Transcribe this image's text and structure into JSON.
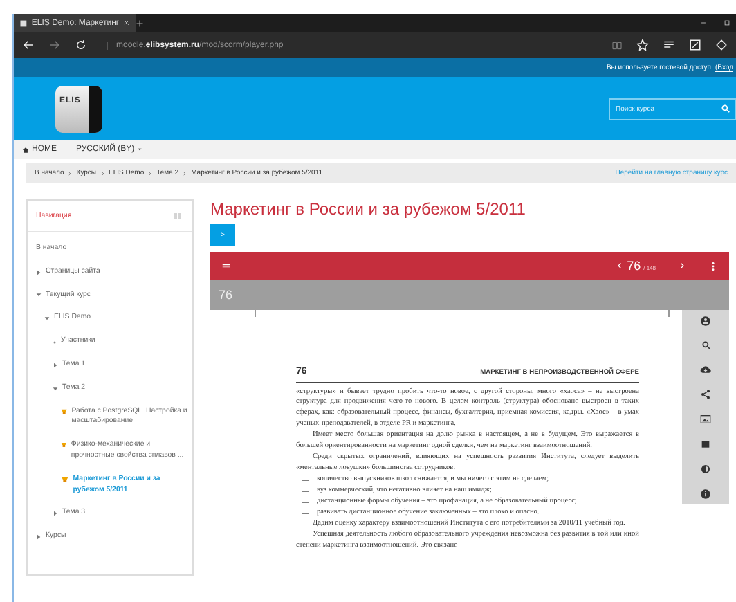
{
  "browser": {
    "tab_title": "ELIS Demo: Маркетинг",
    "url_host": "moodle.",
    "url_domain": "elibsystem.ru",
    "url_path": "/mod/scorm/player.php"
  },
  "guest_bar": {
    "text": "Вы используете гостевой доступ",
    "login": "(Вход"
  },
  "header": {
    "logo": "ELIS",
    "search": {
      "placeholder": "Поиск курса"
    }
  },
  "nav": {
    "home": "HOME",
    "language": "РУССКИЙ (BY)"
  },
  "breadcrumb": {
    "items": [
      "В начало",
      "Курсы",
      "ELIS Demo",
      "Тема 2",
      "Маркетинг в России и за рубежом 5/2011"
    ],
    "course_link": "Перейти на главную страницу курс"
  },
  "navigation": {
    "title": "Навигация",
    "items": [
      {
        "label": "В начало",
        "kind": "plain"
      },
      {
        "label": "Страницы сайта",
        "kind": "node",
        "expanded": false
      },
      {
        "label": "Текущий курс",
        "kind": "node",
        "expanded": true,
        "children": [
          {
            "label": "ELIS Demo",
            "kind": "node",
            "expanded": true,
            "children": [
              {
                "label": "Участники",
                "kind": "bullet"
              },
              {
                "label": "Тема 1",
                "kind": "node",
                "expanded": false
              },
              {
                "label": "Тема 2",
                "kind": "node",
                "expanded": true,
                "children": [
                  {
                    "label": "Работа с PostgreSQL. Настройка и масштабирование",
                    "kind": "activity",
                    "selected": false
                  },
                  {
                    "label": "Физико-механические и прочностные свойства сплавов ...",
                    "kind": "activity",
                    "selected": false
                  },
                  {
                    "label": "Маркетинг в России и за рубежом 5/2011",
                    "kind": "activity",
                    "selected": true
                  }
                ]
              },
              {
                "label": "Тема 3",
                "kind": "node",
                "expanded": false
              }
            ]
          }
        ]
      },
      {
        "label": "Курсы",
        "kind": "node",
        "expanded": false
      }
    ]
  },
  "page_title": "Маркетинг в России и за рубежом 5/2011",
  "toggle_button": ">",
  "viewer": {
    "page": "76",
    "total": "/ 148",
    "page_label": "76"
  },
  "document": {
    "page_number": "76",
    "running_head": "МАРКЕТИНГ В НЕПРОИЗВОДСТВЕННОЙ СФЕРЕ",
    "blocks": [
      {
        "kind": "para",
        "indent": false,
        "text": "«структуры» и бывает трудно пробить что-то новое, с другой стороны, много «хаоса» – не выстроена структура для продвижения чего-то нового. В целом контроль (структура) обосновано выстроен в таких сферах, как: образовательный процесс, финансы, бухгалтерия, приемная комиссия, кадры. «Хаос» – в умах ученых-преподавателей, в отделе PR и маркетинга."
      },
      {
        "kind": "para",
        "indent": true,
        "text": "Имеет место большая ориентация на долю рынка в настоящем, а не в будущем. Это выражается в большей ориентированности на маркетинг одной сделки, чем на маркетинг взаимоотношений."
      },
      {
        "kind": "para",
        "indent": true,
        "text": "Среди скрытых ограничений, влияющих на успешность развития Института, следует выделить «ментальные ловушки» большинства сотрудников:"
      },
      {
        "kind": "dash",
        "text": "количество выпускников школ снижается, и мы ничего с этим не сделаем;"
      },
      {
        "kind": "dash",
        "text": "вуз коммерческий, что негативно влияет на наш имидж;"
      },
      {
        "kind": "dash",
        "text": "дистанционные формы обучения – это профанация, а не образовательный процесс;"
      },
      {
        "kind": "dash",
        "text": "развивать дистанционное обучение заключенных – это плохо и опасно."
      },
      {
        "kind": "para",
        "indent": true,
        "text": "Дадим оценку характеру взаимоотношений Института с его потребителями за 2010/11 учебный год."
      },
      {
        "kind": "para",
        "indent": true,
        "text": "Успешная деятельность любого образовательного учреждения невозможна без развития в той или иной степени маркетинга взаимоотношений. Это связано"
      }
    ]
  }
}
